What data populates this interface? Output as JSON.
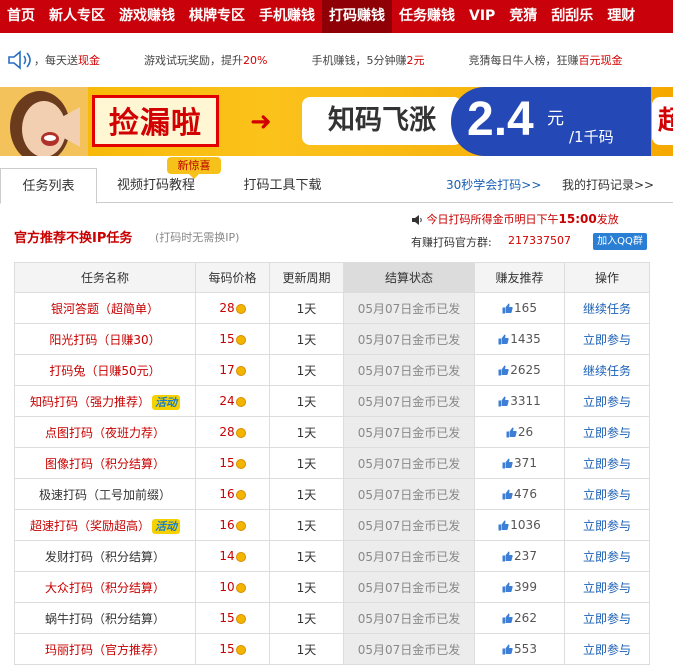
{
  "nav": {
    "items": [
      "首页",
      "新人专区",
      "游戏赚钱",
      "棋牌专区",
      "手机赚钱",
      "打码赚钱",
      "任务赚钱",
      "VIP",
      "竞猜",
      "刮刮乐",
      "理财"
    ],
    "active_index": 5,
    "color": "#c8010a"
  },
  "ticker": {
    "speaker_icon": "speaker-icon",
    "items": [
      {
        "pre": "，每天送",
        "hl": "现金",
        "post": ""
      },
      {
        "pre": "游戏试玩奖励，提升",
        "hl": "20%",
        "post": ""
      },
      {
        "pre": "手机赚钱，5分钟赚",
        "hl": "2元",
        "post": ""
      },
      {
        "pre": "竞猜每日牛人榜，狂赚",
        "hl": "百元现金",
        "post": ""
      }
    ]
  },
  "banner": {
    "slogan": "捡漏啦",
    "arrow": "➜",
    "rise": "知码飞涨",
    "price": "2.4",
    "unit": "元",
    "sub": "/1千码",
    "tail": "超"
  },
  "tabs": {
    "items": [
      "任务列表",
      "视频打码教程",
      "打码工具下载"
    ],
    "badge": "新惊喜",
    "learn_link": "30秒学会打码>>",
    "record_link": "我的打码记录>>"
  },
  "section": {
    "title": "官方推荐不换IP任务",
    "subtitle": "(打码时无需换IP)",
    "notice_pre": "今日打码所得金币明日下午",
    "notice_time": "15:00",
    "notice_post": "发放",
    "qq_label": "有赚打码官方群:",
    "qq_number": "217337507",
    "qq_button": "加入QQ群"
  },
  "table": {
    "headers": [
      "任务名称",
      "每码价格",
      "更新周期",
      "结算状态",
      "赚友推荐",
      "操作"
    ],
    "rows": [
      {
        "name": "银河答题（超简单）",
        "red": true,
        "activity": false,
        "price": "28",
        "cycle": "1天",
        "status": "05月07日金币已发",
        "likes": "165",
        "action": "继续任务"
      },
      {
        "name": "阳光打码（日赚30）",
        "red": true,
        "activity": false,
        "price": "15",
        "cycle": "1天",
        "status": "05月07日金币已发",
        "likes": "1435",
        "action": "立即参与"
      },
      {
        "name": "打码兔（日赚50元）",
        "red": true,
        "activity": false,
        "price": "17",
        "cycle": "1天",
        "status": "05月07日金币已发",
        "likes": "2625",
        "action": "继续任务"
      },
      {
        "name": "知码打码（强力推荐）",
        "red": true,
        "activity": true,
        "price": "24",
        "cycle": "1天",
        "status": "05月07日金币已发",
        "likes": "3311",
        "action": "立即参与"
      },
      {
        "name": "点图打码（夜班力荐）",
        "red": true,
        "activity": false,
        "price": "28",
        "cycle": "1天",
        "status": "05月07日金币已发",
        "likes": "26",
        "action": "立即参与"
      },
      {
        "name": "图像打码（积分结算）",
        "red": true,
        "activity": false,
        "price": "15",
        "cycle": "1天",
        "status": "05月07日金币已发",
        "likes": "371",
        "action": "立即参与"
      },
      {
        "name": "极速打码（工号加前缀）",
        "red": false,
        "activity": false,
        "price": "16",
        "cycle": "1天",
        "status": "05月07日金币已发",
        "likes": "476",
        "action": "立即参与"
      },
      {
        "name": "超速打码（奖励超高）",
        "red": true,
        "activity": true,
        "price": "16",
        "cycle": "1天",
        "status": "05月07日金币已发",
        "likes": "1036",
        "action": "立即参与"
      },
      {
        "name": "发财打码（积分结算）",
        "red": false,
        "activity": false,
        "price": "14",
        "cycle": "1天",
        "status": "05月07日金币已发",
        "likes": "237",
        "action": "立即参与"
      },
      {
        "name": "大众打码（积分结算）",
        "red": true,
        "activity": false,
        "price": "10",
        "cycle": "1天",
        "status": "05月07日金币已发",
        "likes": "399",
        "action": "立即参与"
      },
      {
        "name": "蜗牛打码（积分结算）",
        "red": false,
        "activity": false,
        "price": "15",
        "cycle": "1天",
        "status": "05月07日金币已发",
        "likes": "262",
        "action": "立即参与"
      },
      {
        "name": "玛丽打码（官方推荐）",
        "red": true,
        "activity": false,
        "price": "15",
        "cycle": "1天",
        "status": "05月07日金币已发",
        "likes": "553",
        "action": "立即参与"
      }
    ],
    "activity_label": "活动"
  }
}
